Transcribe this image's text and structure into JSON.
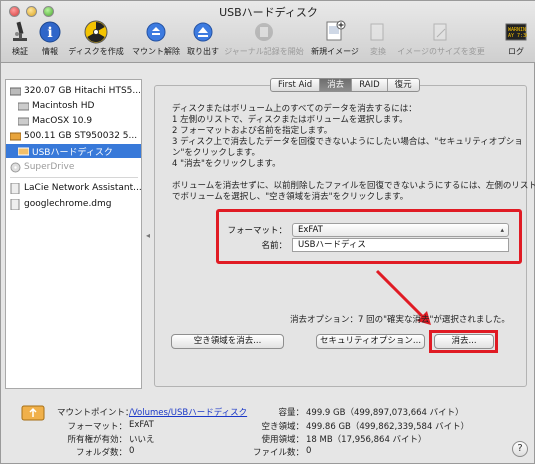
{
  "window": {
    "title": "USBハードディスク"
  },
  "toolbar": {
    "verify": "検証",
    "info": "情報",
    "burn": "ディスクを作成",
    "unmount": "マウント解除",
    "eject": "取り出す",
    "journal": "ジャーナル記録を開始",
    "new_image": "新規イメージ",
    "convert": "変換",
    "resize": "イメージのサイズを変更",
    "log": "ログ"
  },
  "sidebar": {
    "items": [
      {
        "label": "320.07 GB Hitachi HTS5..."
      },
      {
        "label": "Macintosh HD"
      },
      {
        "label": "MacOSX 10.9"
      },
      {
        "label": "500.11 GB ST950032 5..."
      },
      {
        "label": "USBハードディスク"
      },
      {
        "label": "SuperDrive"
      },
      {
        "label": "LaCie Network Assistant..."
      },
      {
        "label": "googlechrome.dmg"
      }
    ]
  },
  "tabs": [
    "First Aid",
    "消去",
    "RAID",
    "復元"
  ],
  "instructions": [
    "ディスクまたはボリューム上のすべてのデータを消去するには：",
    "1  左側のリストで、ディスクまたはボリュームを選択します。",
    "2  フォーマットおよび名前を指定します。",
    "3  ディスク上で消去したデータを回復できないようにしたい場合は、\"セキュリティオプショ",
    "    ン\"をクリックします。",
    "4  \"消去\"をクリックします。",
    "",
    "ボリュームを消去せずに、以前削除したファイルを回復できないようにするには、左側のリスト",
    "でボリュームを選択し、\"空き領域を消去\"をクリックします。"
  ],
  "form": {
    "format_label": "フォーマット：",
    "format_value": "ExFAT",
    "name_label": "名前：",
    "name_value": "USBハードディス"
  },
  "erase_option_text": "消去オプション：7 回の\"確実な消去\"が選択されました。",
  "buttons": {
    "erase_free_space": "空き領域を消去...",
    "security_options": "セキュリティオプション...",
    "erase": "消去..."
  },
  "footer": {
    "mount_point_label": "マウントポイント：",
    "mount_point_value": "/Volumes/USBハードディスク",
    "format_label": "フォーマット：",
    "format_value": "ExFAT",
    "owners_label": "所有権が有効：",
    "owners_value": "いいえ",
    "folders_label": "フォルダ数：",
    "folders_value": "0",
    "capacity_label": "容量：",
    "capacity_value": "499.9 GB（499,897,073,664 バイト）",
    "available_label": "空き領域：",
    "available_value": "499.86 GB（499,862,339,584 バイト）",
    "used_label": "使用領域：",
    "used_value": "18 MB（17,956,864 バイト）",
    "files_label": "ファイル数：",
    "files_value": "0"
  },
  "colors": {
    "selection": "#3879d9",
    "highlight_box": "#e01b24",
    "link": "#1a37c7"
  }
}
